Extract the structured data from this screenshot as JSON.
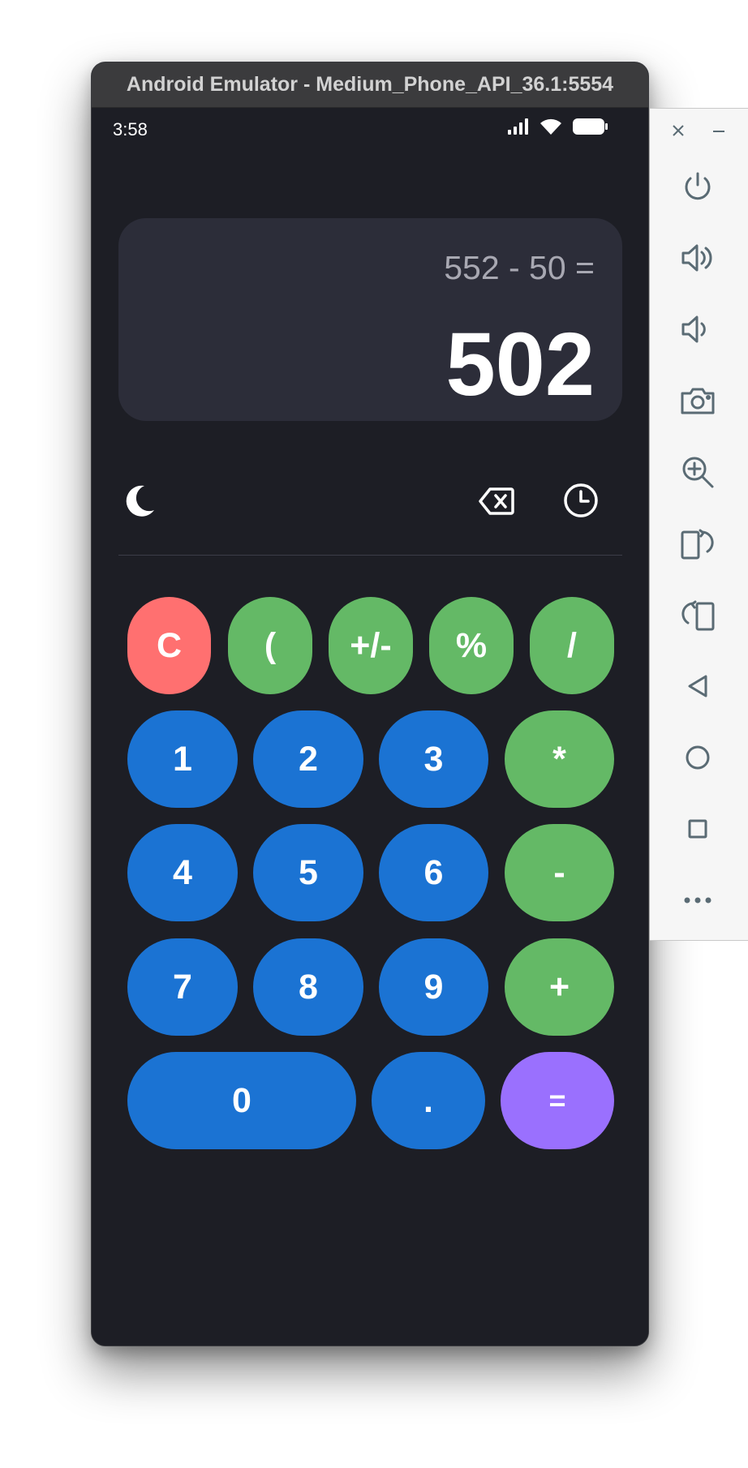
{
  "window": {
    "title": "Android Emulator - Medium_Phone_API_36.1:5554"
  },
  "status_bar": {
    "time": "3:58"
  },
  "display": {
    "expression": "552 - 50 =",
    "result": "502"
  },
  "keypad": {
    "rows": [
      [
        {
          "label": "C",
          "color": "red"
        },
        {
          "label": "(",
          "color": "green"
        },
        {
          "label": "+/-",
          "color": "green"
        },
        {
          "label": "%",
          "color": "green"
        },
        {
          "label": "/",
          "color": "green"
        }
      ],
      [
        {
          "label": "1",
          "color": "blue"
        },
        {
          "label": "2",
          "color": "blue"
        },
        {
          "label": "3",
          "color": "blue"
        },
        {
          "label": "*",
          "color": "green"
        }
      ],
      [
        {
          "label": "4",
          "color": "blue"
        },
        {
          "label": "5",
          "color": "blue"
        },
        {
          "label": "6",
          "color": "blue"
        },
        {
          "label": "-",
          "color": "green"
        }
      ],
      [
        {
          "label": "7",
          "color": "blue"
        },
        {
          "label": "8",
          "color": "blue"
        },
        {
          "label": "9",
          "color": "blue"
        },
        {
          "label": "+",
          "color": "green"
        }
      ],
      [
        {
          "label": "0",
          "color": "blue"
        },
        {
          "label": ".",
          "color": "blue"
        },
        {
          "label": "=",
          "color": "purple"
        }
      ]
    ]
  },
  "colors": {
    "background": "#1d1e25",
    "display_panel": "#2c2d39",
    "clear": "#ff7070",
    "operator": "#64b966",
    "digit": "#1b73d3",
    "equals": "#9a70fe"
  },
  "icons": {
    "toolbar": [
      "moon-icon",
      "backspace-icon",
      "history-icon"
    ],
    "side_toolbar": [
      "close-icon",
      "minimize-icon",
      "power-icon",
      "volume-up-icon",
      "volume-down-icon",
      "camera-icon",
      "zoom-icon",
      "rotate-left-icon",
      "rotate-right-icon",
      "back-icon",
      "home-icon",
      "overview-icon",
      "more-icon"
    ]
  }
}
